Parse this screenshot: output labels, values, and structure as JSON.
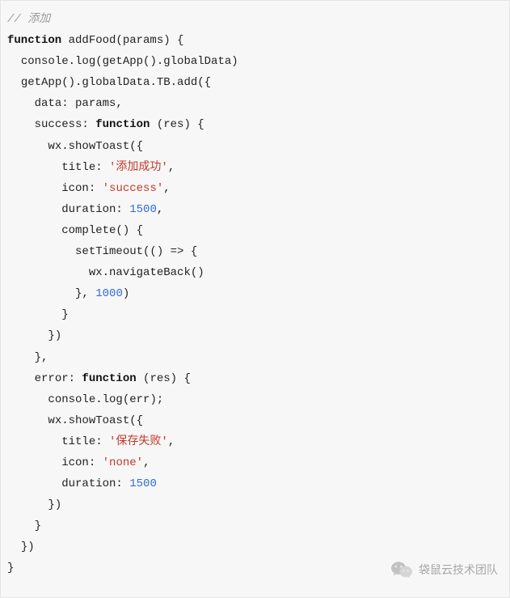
{
  "code": {
    "lines": [
      {
        "indent": 0,
        "tokens": [
          {
            "cls": "cm-comment",
            "t": "// 添加"
          }
        ]
      },
      {
        "indent": 0,
        "tokens": [
          {
            "cls": "cm-keyword",
            "t": "function"
          },
          {
            "cls": "cm-plain",
            "t": " addFood(params) {"
          }
        ]
      },
      {
        "indent": 1,
        "tokens": [
          {
            "cls": "cm-plain",
            "t": "console.log(getApp().globalData)"
          }
        ]
      },
      {
        "indent": 1,
        "tokens": [
          {
            "cls": "cm-plain",
            "t": "getApp().globalData.TB.add({"
          }
        ]
      },
      {
        "indent": 2,
        "tokens": [
          {
            "cls": "cm-plain",
            "t": "data: params,"
          }
        ]
      },
      {
        "indent": 2,
        "tokens": [
          {
            "cls": "cm-plain",
            "t": "success: "
          },
          {
            "cls": "cm-keyword",
            "t": "function"
          },
          {
            "cls": "cm-plain",
            "t": " (res) {"
          }
        ]
      },
      {
        "indent": 3,
        "tokens": [
          {
            "cls": "cm-plain",
            "t": "wx.showToast({"
          }
        ]
      },
      {
        "indent": 4,
        "tokens": [
          {
            "cls": "cm-plain",
            "t": "title: "
          },
          {
            "cls": "cm-string",
            "t": "'添加成功'"
          },
          {
            "cls": "cm-plain",
            "t": ","
          }
        ]
      },
      {
        "indent": 4,
        "tokens": [
          {
            "cls": "cm-plain",
            "t": "icon: "
          },
          {
            "cls": "cm-string",
            "t": "'success'"
          },
          {
            "cls": "cm-plain",
            "t": ","
          }
        ]
      },
      {
        "indent": 4,
        "tokens": [
          {
            "cls": "cm-plain",
            "t": "duration: "
          },
          {
            "cls": "cm-number",
            "t": "1500"
          },
          {
            "cls": "cm-plain",
            "t": ","
          }
        ]
      },
      {
        "indent": 4,
        "tokens": [
          {
            "cls": "cm-plain",
            "t": "complete() {"
          }
        ]
      },
      {
        "indent": 5,
        "tokens": [
          {
            "cls": "cm-plain",
            "t": "setTimeout(() => {"
          }
        ]
      },
      {
        "indent": 6,
        "tokens": [
          {
            "cls": "cm-plain",
            "t": "wx.navigateBack()"
          }
        ]
      },
      {
        "indent": 5,
        "tokens": [
          {
            "cls": "cm-plain",
            "t": "}, "
          },
          {
            "cls": "cm-number",
            "t": "1000"
          },
          {
            "cls": "cm-plain",
            "t": ")"
          }
        ]
      },
      {
        "indent": 4,
        "tokens": [
          {
            "cls": "cm-plain",
            "t": "}"
          }
        ]
      },
      {
        "indent": 3,
        "tokens": [
          {
            "cls": "cm-plain",
            "t": "})"
          }
        ]
      },
      {
        "indent": 2,
        "tokens": [
          {
            "cls": "cm-plain",
            "t": "},"
          }
        ]
      },
      {
        "indent": 2,
        "tokens": [
          {
            "cls": "cm-plain",
            "t": "error: "
          },
          {
            "cls": "cm-keyword",
            "t": "function"
          },
          {
            "cls": "cm-plain",
            "t": " (res) {"
          }
        ]
      },
      {
        "indent": 3,
        "tokens": [
          {
            "cls": "cm-plain",
            "t": "console.log(err);"
          }
        ]
      },
      {
        "indent": 3,
        "tokens": [
          {
            "cls": "cm-plain",
            "t": "wx.showToast({"
          }
        ]
      },
      {
        "indent": 4,
        "tokens": [
          {
            "cls": "cm-plain",
            "t": "title: "
          },
          {
            "cls": "cm-string",
            "t": "'保存失败'"
          },
          {
            "cls": "cm-plain",
            "t": ","
          }
        ]
      },
      {
        "indent": 4,
        "tokens": [
          {
            "cls": "cm-plain",
            "t": "icon: "
          },
          {
            "cls": "cm-string",
            "t": "'none'"
          },
          {
            "cls": "cm-plain",
            "t": ","
          }
        ]
      },
      {
        "indent": 4,
        "tokens": [
          {
            "cls": "cm-plain",
            "t": "duration: "
          },
          {
            "cls": "cm-number",
            "t": "1500"
          }
        ]
      },
      {
        "indent": 3,
        "tokens": [
          {
            "cls": "cm-plain",
            "t": "})"
          }
        ]
      },
      {
        "indent": 2,
        "tokens": [
          {
            "cls": "cm-plain",
            "t": "}"
          }
        ]
      },
      {
        "indent": 1,
        "tokens": [
          {
            "cls": "cm-plain",
            "t": "})"
          }
        ]
      },
      {
        "indent": 0,
        "tokens": [
          {
            "cls": "cm-plain",
            "t": "}"
          }
        ]
      }
    ],
    "indent_unit": "  "
  },
  "watermark": {
    "text": "袋鼠云技术团队"
  }
}
